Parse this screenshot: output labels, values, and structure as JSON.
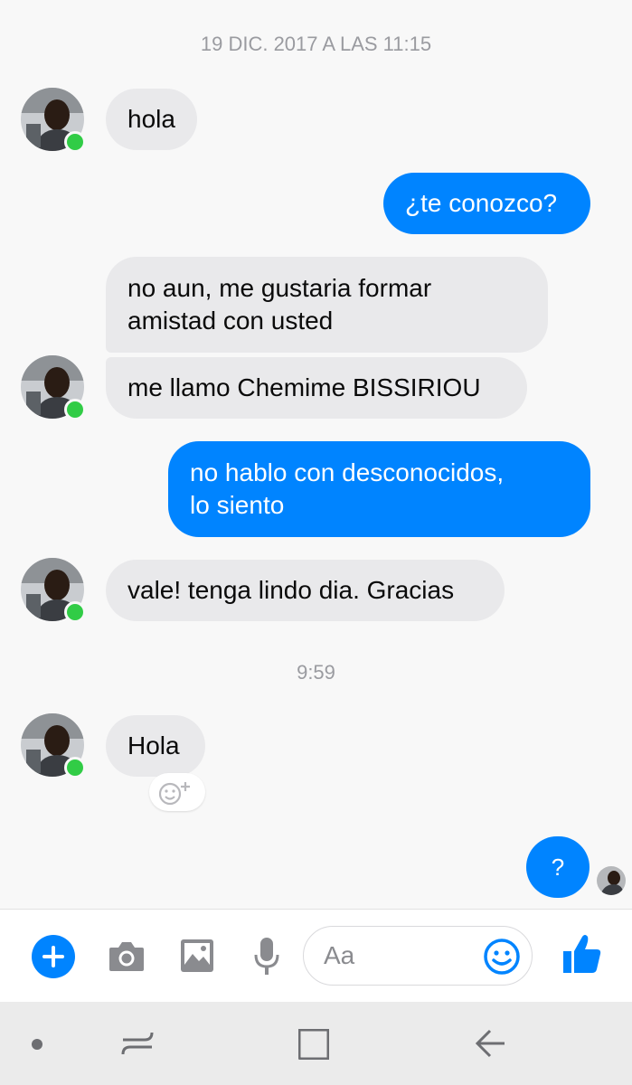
{
  "thread": {
    "timestamp_1": "19 DIC. 2017 A LAS 11:15",
    "timestamp_2": "9:59",
    "messages": [
      {
        "from": "them",
        "text": "hola"
      },
      {
        "from": "me",
        "text": "¿te conozco?"
      },
      {
        "from": "them",
        "text": "no aun, me gustaria formar amistad con usted"
      },
      {
        "from": "them",
        "text": "me llamo Chemime BISSIRIOU"
      },
      {
        "from": "me",
        "text": "no hablo con desconocidos, lo siento"
      },
      {
        "from": "them",
        "text": "vale! tenga lindo dia. Gracias"
      },
      {
        "from": "them",
        "text": "Hola"
      },
      {
        "from": "me",
        "text": "?"
      }
    ],
    "msg3_line1": "no aun, me gustaria formar",
    "msg3_line2": "amistad con usted",
    "msg5_line1": "no hablo con desconocidos,",
    "msg5_line2": "lo siento"
  },
  "composer": {
    "placeholder": "Aa",
    "accent": "#0084ff",
    "icons": [
      "plus-icon",
      "camera-icon",
      "image-icon",
      "microphone-icon",
      "emoji-icon",
      "thumbs-up-icon"
    ]
  },
  "colors": {
    "outgoing_bubble": "#0084ff",
    "incoming_bubble": "#e9e9eb",
    "online_dot": "#31cc46"
  },
  "navbar": {
    "icons": [
      "home-dot-icon",
      "recent-apps-icon",
      "overview-square-icon",
      "back-arrow-icon"
    ]
  }
}
